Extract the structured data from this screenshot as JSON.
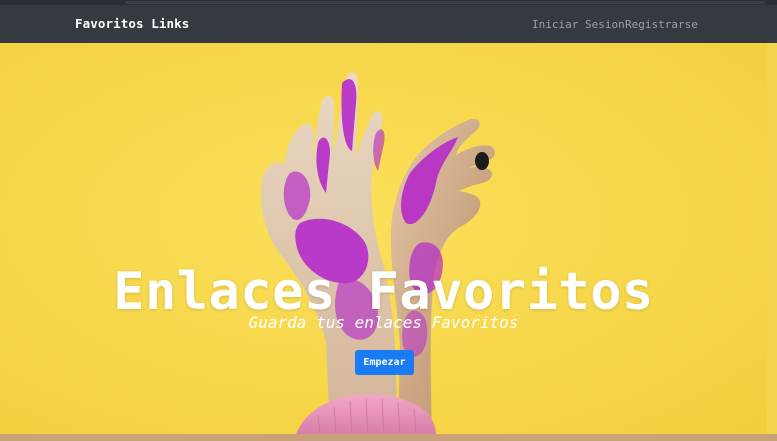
{
  "navbar": {
    "brand": "Favoritos Links",
    "links": [
      {
        "label": "Iniciar Sesion"
      },
      {
        "label": "Registrarse"
      }
    ]
  },
  "hero": {
    "title": "Enlaces Favoritos",
    "subtitle": "Guarda tus enlaces Favoritos",
    "cta_label": "Empezar",
    "background_image": "hands-with-pink-glitter-on-yellow"
  },
  "colors": {
    "navbar_bg": "#343a40",
    "hero_bg": "#f6d84c",
    "button_bg": "#1a7cf5",
    "glitter": "#b52bc9",
    "frame": "#c9a277"
  }
}
